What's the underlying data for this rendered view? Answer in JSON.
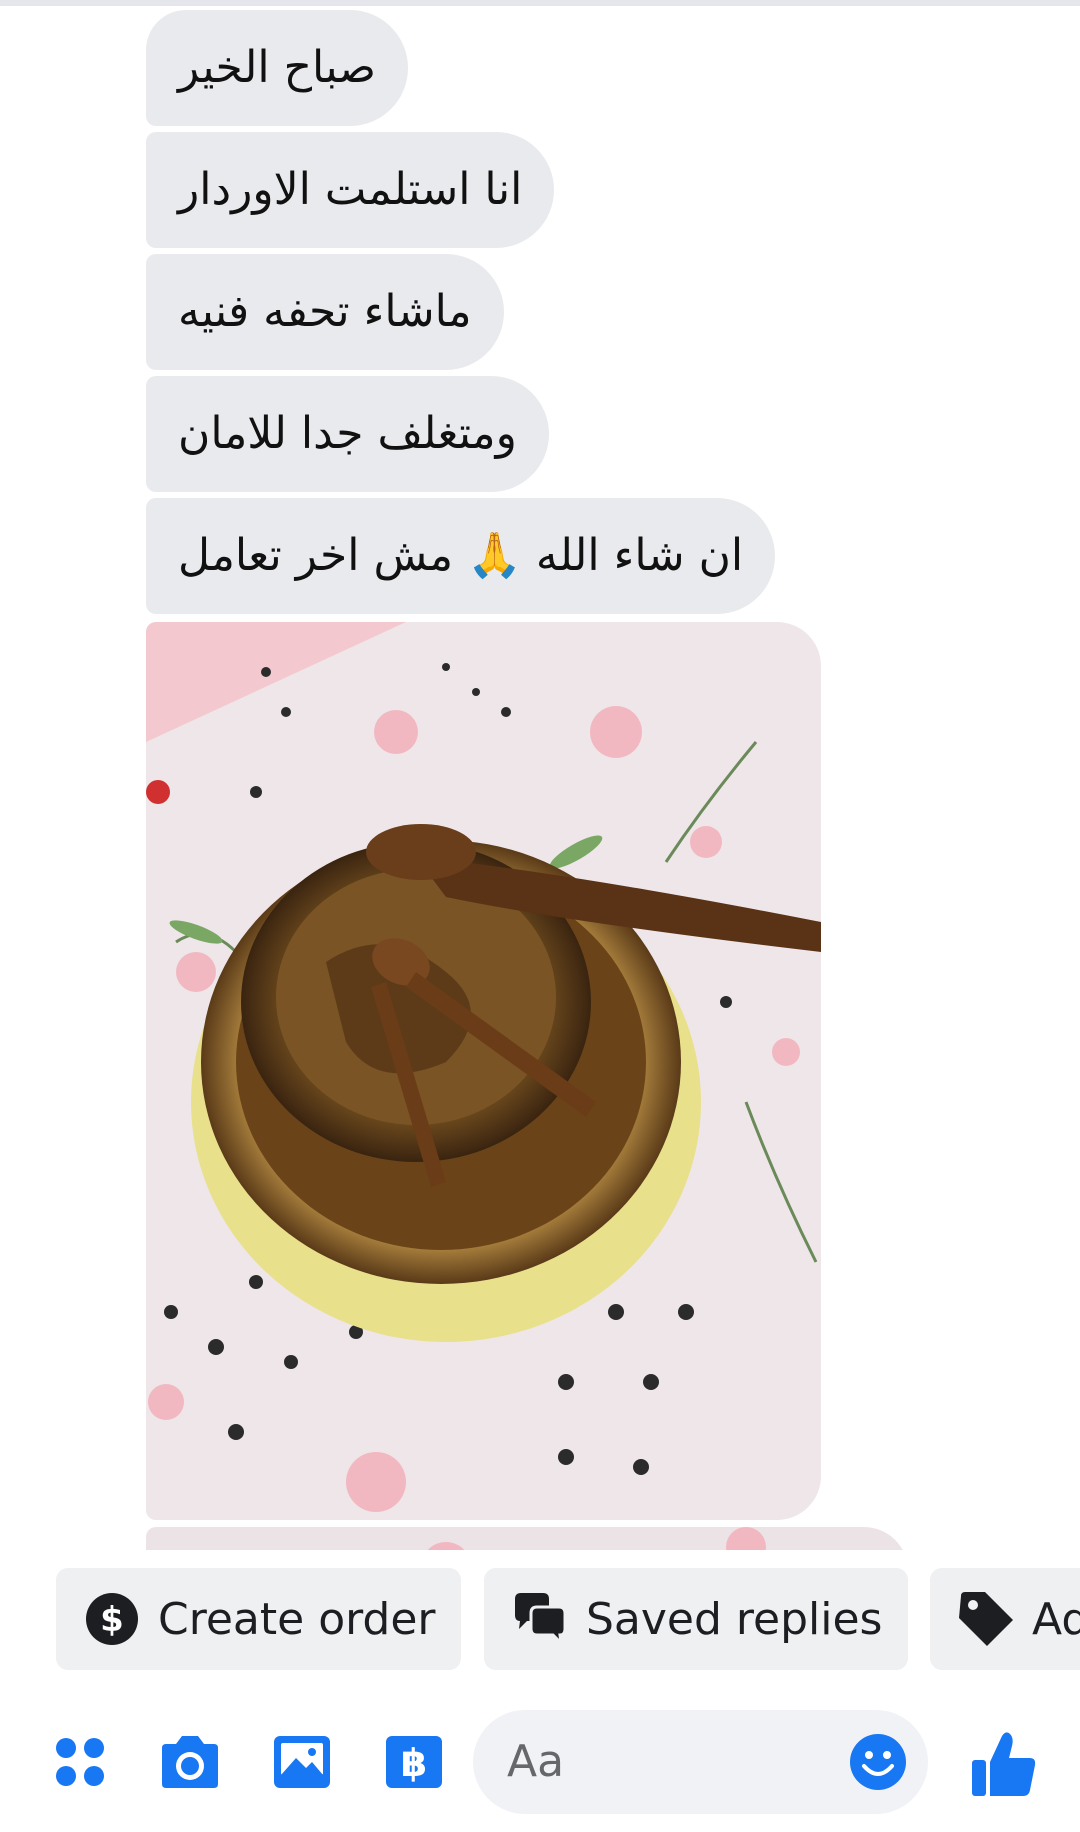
{
  "messages": [
    {
      "text": "صباح الخير"
    },
    {
      "text": "انا استلمت الاوردار"
    },
    {
      "text": "ماشاء تحفه فنيه"
    },
    {
      "text": "ومتغلف جدا للامان"
    },
    {
      "text": "ان شاء الله 🙏 مش اخر تعامل"
    }
  ],
  "quick_actions": [
    {
      "label": "Create order",
      "icon": "dollar-circle-icon"
    },
    {
      "label": "Saved replies",
      "icon": "chat-bubbles-icon"
    },
    {
      "label": "Ad",
      "icon": "tag-icon"
    }
  ],
  "composer": {
    "placeholder": "Aa",
    "icons": [
      "apps-icon",
      "camera-icon",
      "gallery-icon",
      "payment-icon",
      "emoji-icon",
      "like-icon"
    ]
  },
  "colors": {
    "accent": "#1877f2",
    "bubble": "#e9eaed",
    "chip": "#eef0f2",
    "input": "#f0f2f5"
  }
}
